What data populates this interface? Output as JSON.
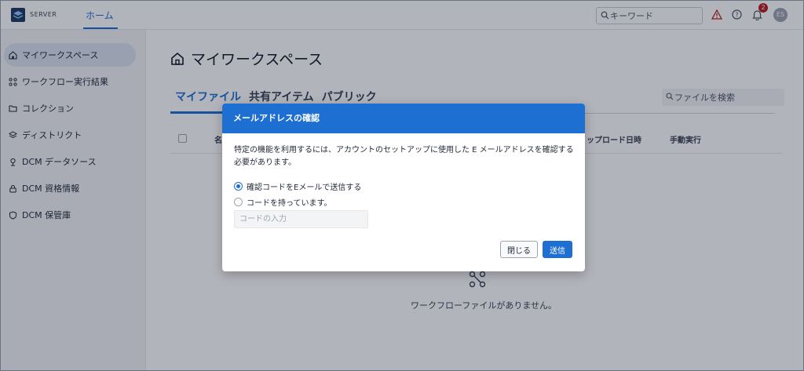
{
  "header": {
    "brand": "SERVER",
    "nav_home": "ホーム",
    "search_placeholder": "キーワード",
    "notification_count": "2",
    "avatar_initials": "ES"
  },
  "sidebar": {
    "items": [
      {
        "label": "マイワークスペース",
        "icon": "home-icon",
        "active": true
      },
      {
        "label": "ワークフロー実行結果",
        "icon": "workflow-icon"
      },
      {
        "label": "コレクション",
        "icon": "folder-icon"
      },
      {
        "label": "ディストリクト",
        "icon": "layers-icon"
      },
      {
        "label": "DCM データソース",
        "icon": "datasource-icon"
      },
      {
        "label": "DCM 資格情報",
        "icon": "lock-icon"
      },
      {
        "label": "DCM 保管庫",
        "icon": "shield-icon"
      }
    ]
  },
  "main": {
    "title": "マイワークスペース",
    "tabs": [
      "マイファイル",
      "共有アイテム",
      "パブリック"
    ],
    "file_search_placeholder": "ファイルを検索",
    "columns": {
      "name": "名",
      "upload_date": "ップロード日時",
      "manual_run": "手動実行"
    },
    "empty_message": "ワークフローファイルがありません。"
  },
  "modal": {
    "title": "メールアドレスの確認",
    "message": "特定の機能を利用するには、アカウントのセットアップに使用した E メールアドレスを確認する必要があります。",
    "option_send": "確認コードをEメールで送信する",
    "option_have": "コードを持っています。",
    "code_placeholder": "コードの入力",
    "close_label": "閉じる",
    "send_label": "送信"
  },
  "colors": {
    "accent": "#1d6fd1",
    "warning": "#b91c1c"
  }
}
